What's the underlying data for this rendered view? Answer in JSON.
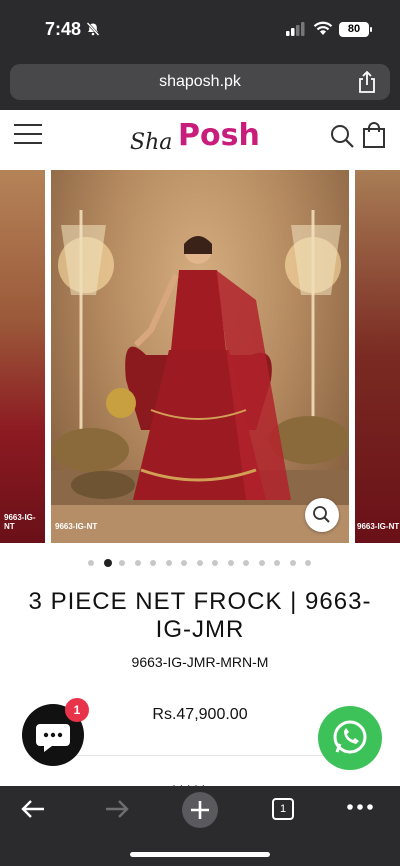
{
  "status_bar": {
    "time": "7:48",
    "battery": "80"
  },
  "browser": {
    "url": "shaposh.pk",
    "tab_count": "1"
  },
  "header": {
    "logo_part1": "Sha",
    "logo_part2": "Posh"
  },
  "gallery": {
    "slide_label_left": "9663-IG-NT",
    "slide_label_right": "9663-IG-NT",
    "dot_count": 15,
    "active_dot": 1
  },
  "product": {
    "title": "3 PIECE NET FROCK | 9663-IG-JMR",
    "sku": "9663-IG-JMR-MRN-M",
    "price": "Rs.47,900.00"
  },
  "chat": {
    "badge_count": "1"
  },
  "colors": {
    "brand": "#c81d7a",
    "whatsapp": "#3dc25a",
    "badge": "#e8334a"
  }
}
